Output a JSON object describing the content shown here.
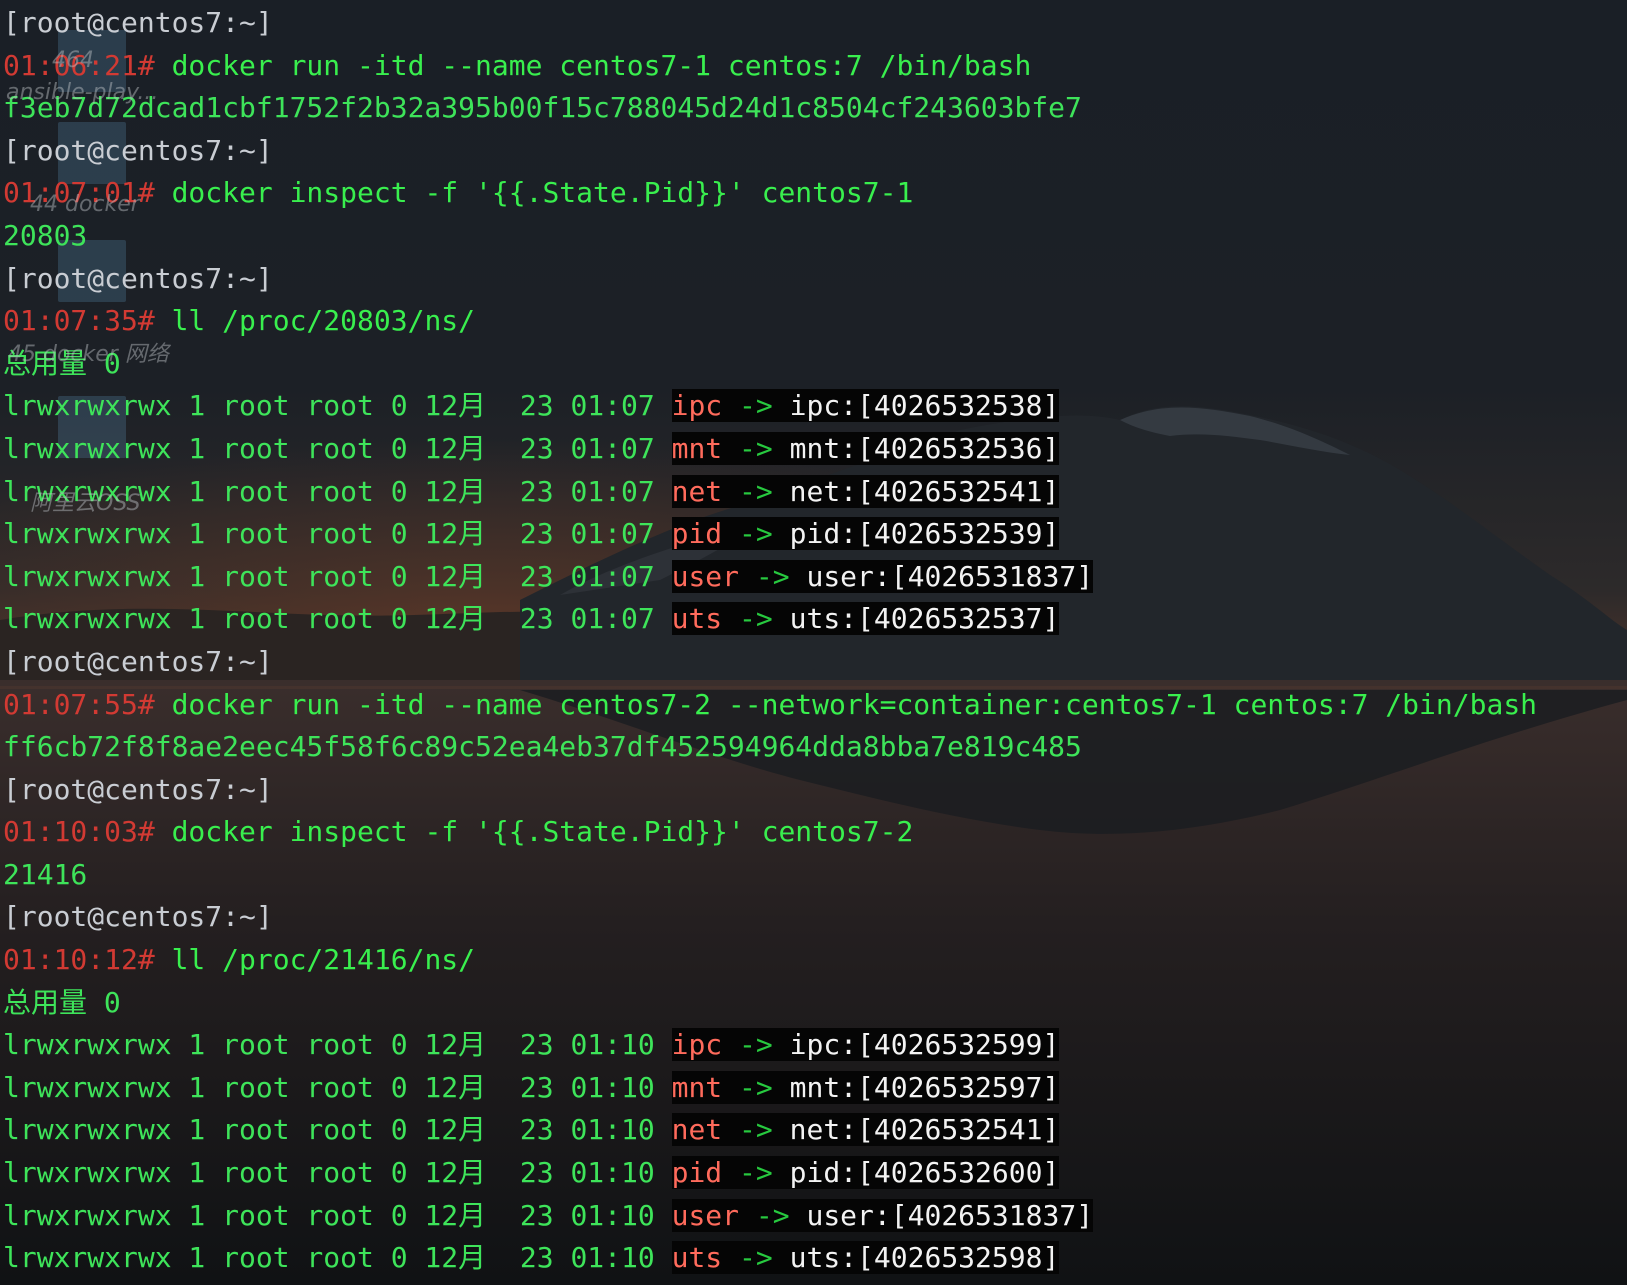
{
  "terminal": {
    "prompt_user": "[root@centos7:~]",
    "lines": [
      {
        "type": "prompt"
      },
      {
        "type": "command",
        "time": "01:06:21#",
        "cmd": " docker run -itd --name centos7-1 centos:7 /bin/bash"
      },
      {
        "type": "output",
        "text": "f3eb7d72dcad1cbf1752f2b32a395b00f15c788045d24d1c8504cf243603bfe7"
      },
      {
        "type": "prompt"
      },
      {
        "type": "command",
        "time": "01:07:01#",
        "cmd": " docker inspect -f '{{.State.Pid}}' centos7-1"
      },
      {
        "type": "output",
        "text": "20803"
      },
      {
        "type": "prompt"
      },
      {
        "type": "command",
        "time": "01:07:35#",
        "cmd": " ll /proc/20803/ns/"
      },
      {
        "type": "output",
        "text": "总用量 0"
      },
      {
        "type": "ns",
        "perm": "lrwxrwxrwx 1 root root 0 12月  23 01:07 ",
        "name": "ipc",
        "arrow": " -> ",
        "target": "ipc:[4026532538]"
      },
      {
        "type": "ns",
        "perm": "lrwxrwxrwx 1 root root 0 12月  23 01:07 ",
        "name": "mnt",
        "arrow": " -> ",
        "target": "mnt:[4026532536]"
      },
      {
        "type": "ns",
        "perm": "lrwxrwxrwx 1 root root 0 12月  23 01:07 ",
        "name": "net",
        "arrow": " -> ",
        "target": "net:[4026532541]"
      },
      {
        "type": "ns",
        "perm": "lrwxrwxrwx 1 root root 0 12月  23 01:07 ",
        "name": "pid",
        "arrow": " -> ",
        "target": "pid:[4026532539]"
      },
      {
        "type": "ns",
        "perm": "lrwxrwxrwx 1 root root 0 12月  23 01:07 ",
        "name": "user",
        "arrow": " -> ",
        "target": "user:[4026531837]"
      },
      {
        "type": "ns",
        "perm": "lrwxrwxrwx 1 root root 0 12月  23 01:07 ",
        "name": "uts",
        "arrow": " -> ",
        "target": "uts:[4026532537]"
      },
      {
        "type": "prompt"
      },
      {
        "type": "command",
        "time": "01:07:55#",
        "cmd": " docker run -itd --name centos7-2 --network=container:centos7-1 centos:7 /bin/bash"
      },
      {
        "type": "output",
        "text": "ff6cb72f8f8ae2eec45f58f6c89c52ea4eb37df452594964dda8bba7e819c485"
      },
      {
        "type": "prompt"
      },
      {
        "type": "command",
        "time": "01:10:03#",
        "cmd": " docker inspect -f '{{.State.Pid}}' centos7-2"
      },
      {
        "type": "output",
        "text": "21416"
      },
      {
        "type": "prompt"
      },
      {
        "type": "command",
        "time": "01:10:12#",
        "cmd": " ll /proc/21416/ns/"
      },
      {
        "type": "output",
        "text": "总用量 0"
      },
      {
        "type": "ns",
        "perm": "lrwxrwxrwx 1 root root 0 12月  23 01:10 ",
        "name": "ipc",
        "arrow": " -> ",
        "target": "ipc:[4026532599]"
      },
      {
        "type": "ns",
        "perm": "lrwxrwxrwx 1 root root 0 12月  23 01:10 ",
        "name": "mnt",
        "arrow": " -> ",
        "target": "mnt:[4026532597]"
      },
      {
        "type": "ns",
        "perm": "lrwxrwxrwx 1 root root 0 12月  23 01:10 ",
        "name": "net",
        "arrow": " -> ",
        "target": "net:[4026532541]"
      },
      {
        "type": "ns",
        "perm": "lrwxrwxrwx 1 root root 0 12月  23 01:10 ",
        "name": "pid",
        "arrow": " -> ",
        "target": "pid:[4026532600]"
      },
      {
        "type": "ns",
        "perm": "lrwxrwxrwx 1 root root 0 12月  23 01:10 ",
        "name": "user",
        "arrow": " -> ",
        "target": "user:[4026531837]"
      },
      {
        "type": "ns",
        "perm": "lrwxrwxrwx 1 root root 0 12月  23 01:10 ",
        "name": "uts",
        "arrow": " -> ",
        "target": "uts:[4026532598]"
      }
    ]
  },
  "desktop_icons": [
    {
      "label": "464"
    },
    {
      "label": "ansible-play..."
    },
    {
      "label": "44 docker"
    },
    {
      "label": "45 docker 网络"
    },
    {
      "label": "阿里云OSS"
    }
  ],
  "colors": {
    "prompt": "#c9cdd3",
    "time": "#d23a33",
    "command": "#39ef4e",
    "output": "#3ee45a",
    "ns_name": "#ff6b5c",
    "ns_target": "#f3f3f3"
  }
}
